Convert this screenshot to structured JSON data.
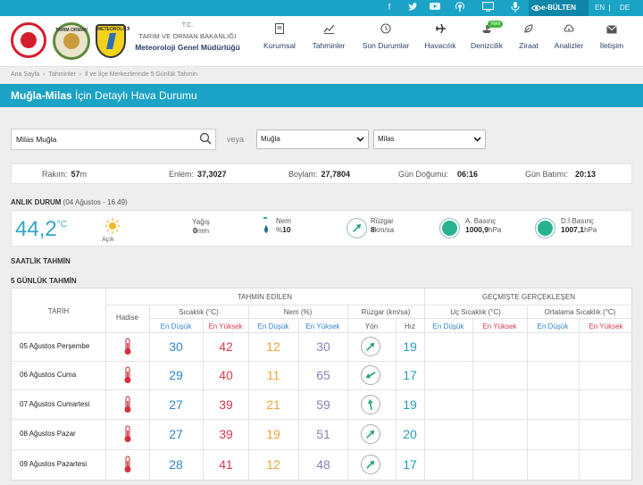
{
  "topbar": {
    "icons": [
      "facebook-icon",
      "twitter-icon",
      "youtube-icon",
      "podcast-icon",
      "tv-icon",
      "microphone-icon"
    ],
    "bulten_label": "e-BÜLTEN",
    "langs": [
      "EN",
      "DE"
    ]
  },
  "header": {
    "ministry_tc": "T.C.",
    "ministry_name": "TARIM VE ORMAN BAKANLIĞI",
    "mgm_name": "Meteoroloji Genel Müdürlüğü",
    "logo2_text": "TARIM ORMAN",
    "logo3_text": "METEOROLOJİ",
    "nav": [
      {
        "label": "Kurumsal",
        "icon": "book-icon"
      },
      {
        "label": "Tahminler",
        "icon": "chart-icon"
      },
      {
        "label": "Son Durumlar",
        "icon": "clock-icon"
      },
      {
        "label": "Havacılık",
        "icon": "plane-icon"
      },
      {
        "label": "Denizcilik",
        "icon": "ship-icon",
        "badge": "Yeni"
      },
      {
        "label": "Ziraat",
        "icon": "leaf-icon"
      },
      {
        "label": "Analizler",
        "icon": "analysis-icon"
      },
      {
        "label": "İletişim",
        "icon": "mail-icon"
      }
    ]
  },
  "breadcrumb": [
    "Ana Sayfa",
    "›",
    "Tahminler",
    "›",
    "İl ve İlçe Merkezlerinde 5 Günlük Tahmin"
  ],
  "title": {
    "place": "Muğla-Milas",
    "rest": " İçin Detaylı Hava Durumu"
  },
  "search": {
    "value": "Milas Muğla",
    "veya": "veya",
    "province": "Muğla",
    "district": "Milas"
  },
  "info": {
    "rakim_label": "Rakım:",
    "rakim_value": "57",
    "rakim_unit": "m",
    "enlem_label": "Enlem:",
    "enlem_value": "37,3027",
    "boylam_label": "Boylam:",
    "boylam_value": "27,7804",
    "dogumu_label": "Gün Doğumu:",
    "dogumu_value": "06:16",
    "batimi_label": "Gün Batımı:",
    "batimi_value": "20:13"
  },
  "current": {
    "heading": "ANLIK DURUM",
    "time": "(04 Ağustos - 16.49)",
    "temp": "44,2",
    "temp_unit": "°C",
    "condition": "Açık",
    "yagis_label": "Yağış",
    "yagis_value": "0",
    "yagis_unit": "mm",
    "nem_label": "Nem",
    "nem_prefix": "%",
    "nem_value": "10",
    "ruzgar_label": "Rüzgar",
    "ruzgar_value": "8",
    "ruzgar_unit": "km/sa",
    "abasinc_label": "A. Basınç",
    "abasinc_value": "1000,9",
    "abasinc_unit": "hPa",
    "dibasinc_label": "D.İ.Basınç",
    "dibasinc_value": "1007,1",
    "dibasinc_unit": "hPa"
  },
  "saatlik_heading": "SAATLİK TAHMİN",
  "besgunluk_heading": "5 GÜNLÜK TAHMİN",
  "table": {
    "tarih": "TARİH",
    "hadise": "Hadise",
    "tahmin_edilen": "TAHMİN EDİLEN",
    "gecmiste": "GEÇMİŞTE GERÇEKLEŞEN",
    "sicaklik": "Sıcaklık (°C)",
    "nem": "Nem (%)",
    "ruzgar": "Rüzgar (km/sa)",
    "uc_sicaklik": "Uç Sıcaklık (°C)",
    "ort_sicaklik": "Ortalama Sıcaklık (°C)",
    "en_dusuk": "En Düşük",
    "en_yuksek": "En Yüksek",
    "yon": "Yön",
    "hiz": "Hız",
    "rows": [
      {
        "date": "05 Ağustos Perşembe",
        "tmin": "30",
        "tmax": "42",
        "hmin": "12",
        "hmax": "30",
        "wind": "19",
        "dir_deg": 225
      },
      {
        "date": "06 Ağustos Cuma",
        "tmin": "29",
        "tmax": "40",
        "hmin": "11",
        "hmax": "65",
        "wind": "17",
        "dir_deg": 60
      },
      {
        "date": "07 Ağustos Cumartesi",
        "tmin": "27",
        "tmax": "39",
        "hmin": "21",
        "hmax": "59",
        "wind": "19",
        "dir_deg": 170
      },
      {
        "date": "08 Ağustos Pazar",
        "tmin": "27",
        "tmax": "39",
        "hmin": "19",
        "hmax": "51",
        "wind": "20",
        "dir_deg": 225
      },
      {
        "date": "09 Ağustos Pazartesi",
        "tmin": "28",
        "tmax": "41",
        "hmin": "12",
        "hmax": "48",
        "wind": "17",
        "dir_deg": 225
      }
    ]
  }
}
